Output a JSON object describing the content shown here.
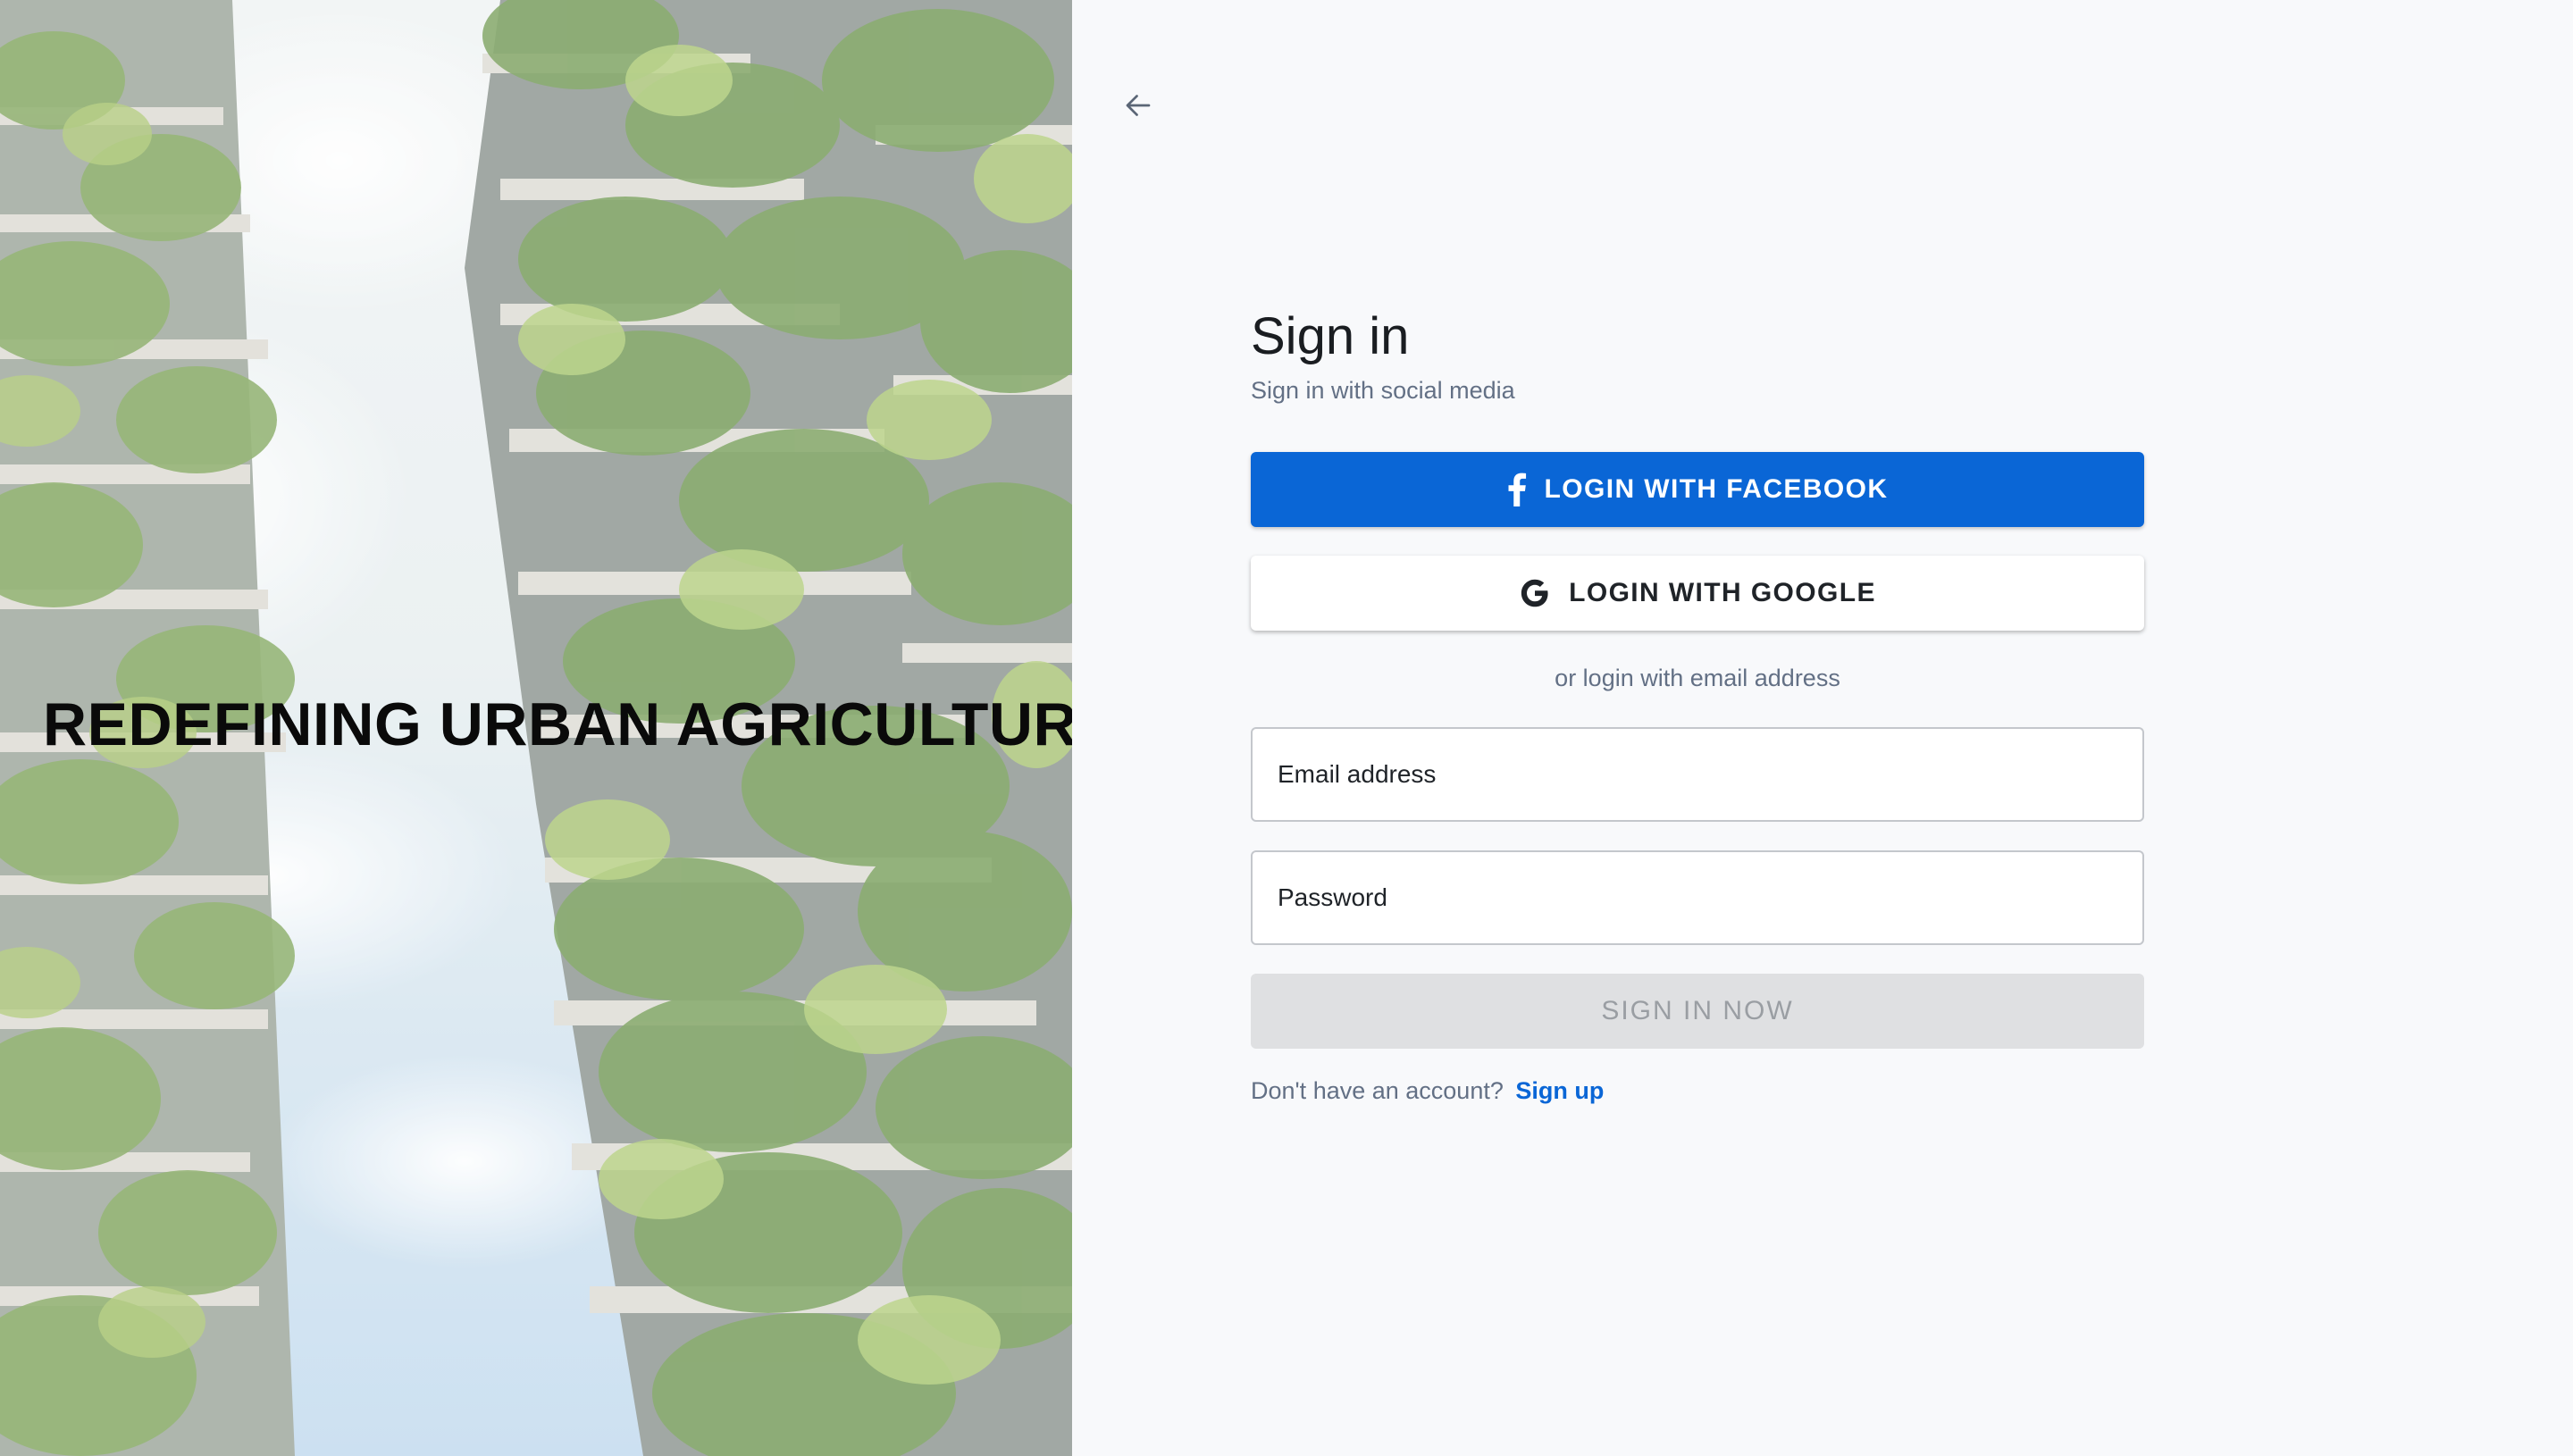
{
  "hero": {
    "title": "REDEFINING URBAN AGRICULTURE",
    "image_icon": "vertical-forest-image"
  },
  "nav": {
    "back_icon": "arrow-left-icon"
  },
  "auth": {
    "title": "Sign in",
    "subtitle": "Sign in with social media",
    "facebook_label": "LOGIN WITH FACEBOOK",
    "facebook_icon": "facebook-icon",
    "google_label": "LOGIN WITH GOOGLE",
    "google_icon": "google-icon",
    "divider_text": "or login with email address",
    "email_placeholder": "Email address",
    "email_value": "",
    "password_placeholder": "Password",
    "password_value": "",
    "submit_label": "SIGN IN NOW",
    "signup_prompt": "Don't have an account?",
    "signup_link": "Sign up"
  },
  "colors": {
    "facebook_blue": "#0a66d6",
    "link_blue": "#0a66d6",
    "muted_text": "#637085",
    "disabled_bg": "#dfe0e2",
    "page_bg": "#f8f9fb"
  }
}
